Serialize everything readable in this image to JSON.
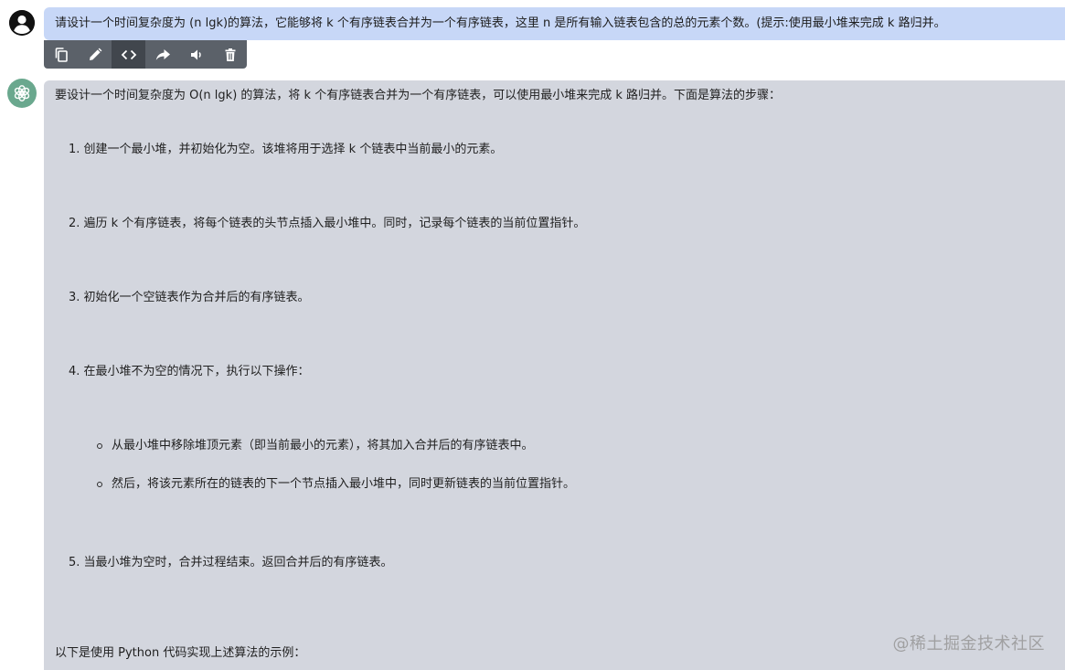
{
  "user_message": {
    "text": "请设计一个时间复杂度为 (n lgk)的算法，它能够将  k 个有序链表合并为一个有序链表，这里 n 是所有输入链表包含的总的元素个数。(提示:使用最小堆来完成 k 路归并。"
  },
  "toolbar": {
    "buttons": [
      {
        "name": "copy",
        "icon": "copy-icon"
      },
      {
        "name": "edit",
        "icon": "pencil-icon"
      },
      {
        "name": "code",
        "icon": "code-icon",
        "active": true
      },
      {
        "name": "share",
        "icon": "share-arrow-icon"
      },
      {
        "name": "speak",
        "icon": "speaker-icon"
      },
      {
        "name": "delete",
        "icon": "trash-icon"
      }
    ]
  },
  "assistant_message": {
    "intro": "要设计一个时间复杂度为 O(n lgk) 的算法，将 k 个有序链表合并为一个有序链表，可以使用最小堆来完成 k 路归并。下面是算法的步骤：",
    "steps": [
      "1. 创建一个最小堆，并初始化为空。该堆将用于选择 k 个链表中当前最小的元素。",
      "2. 遍历 k 个有序链表，将每个链表的头节点插入最小堆中。同时，记录每个链表的当前位置指针。",
      "3. 初始化一个空链表作为合并后的有序链表。",
      "4. 在最小堆不为空的情况下，执行以下操作：",
      "5. 当最小堆为空时，合并过程结束。返回合并后的有序链表。"
    ],
    "substeps": [
      "从最小堆中移除堆顶元素（即当前最小的元素），将其加入合并后的有序链表中。",
      "然后，将该元素所在的链表的下一个节点插入最小堆中，同时更新链表的当前位置指针。"
    ],
    "outro": "以下是使用 Python 代码实现上述算法的示例："
  },
  "watermark": "@稀土掘金技术社区",
  "colors": {
    "user_bubble": "#c7d7f7",
    "answer_bg": "#d3d6de",
    "toolbar_bg": "#5b6169",
    "bot_avatar": "#6aa88e"
  }
}
